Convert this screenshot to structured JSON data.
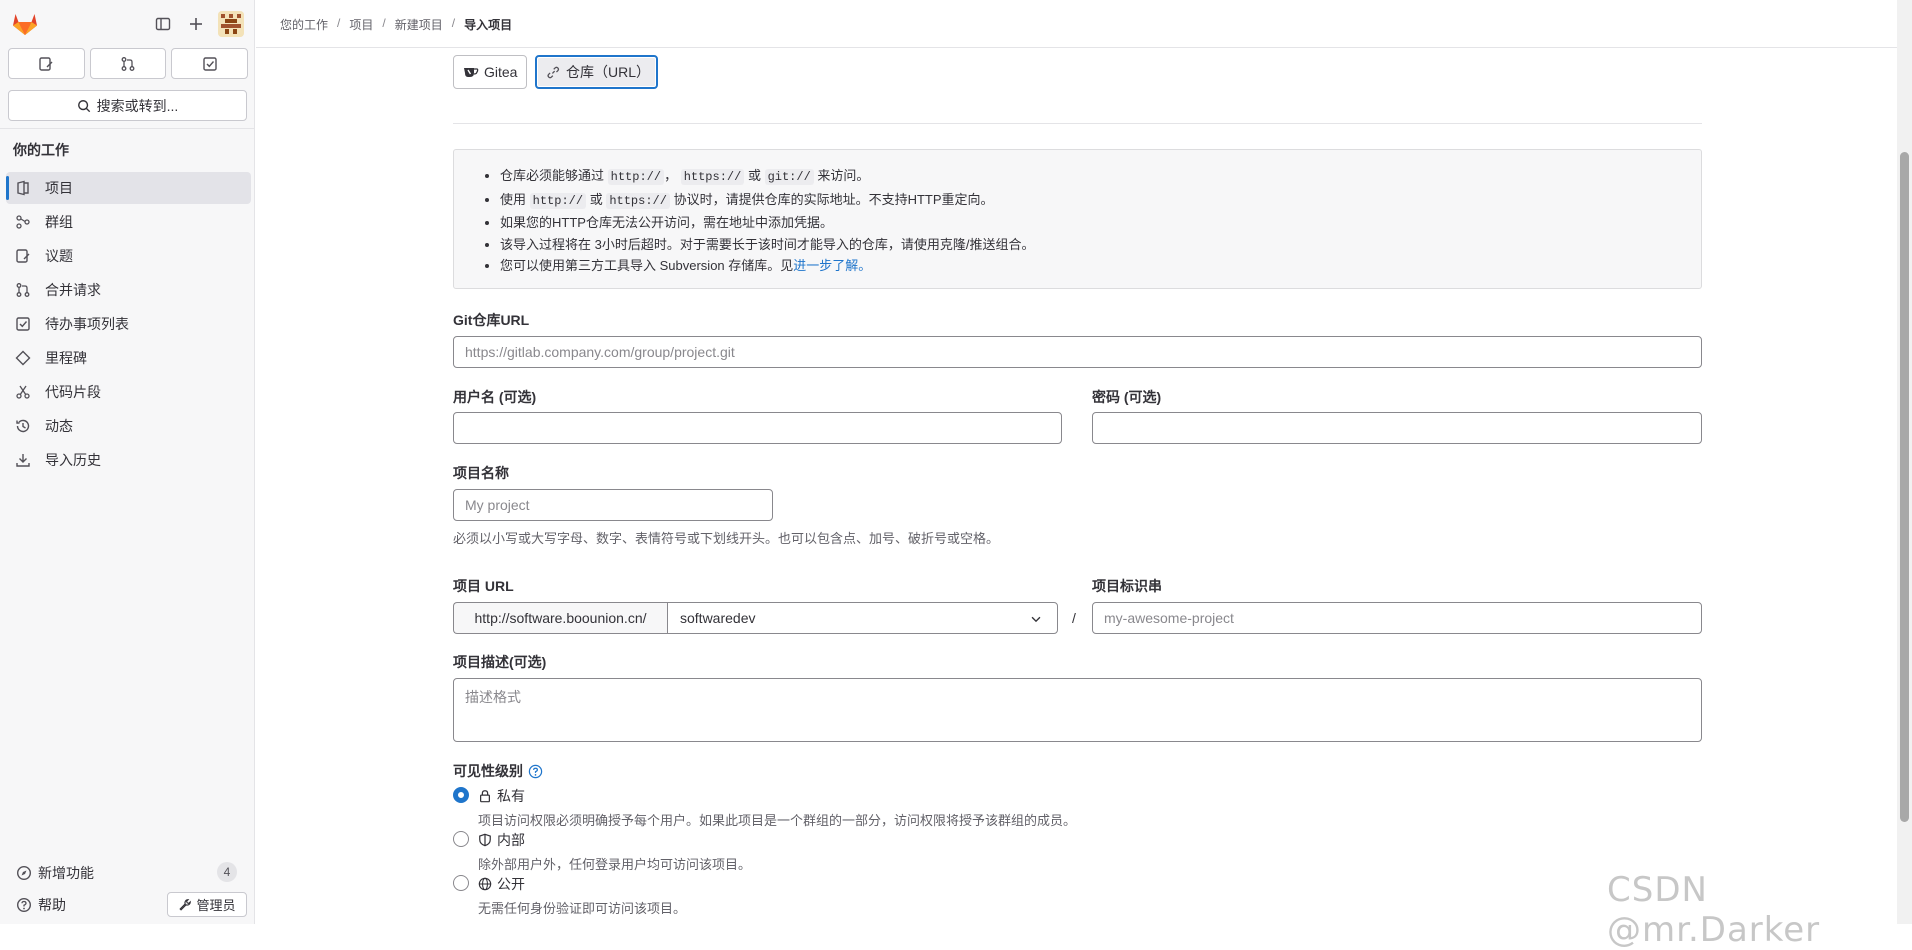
{
  "sidebar": {
    "search_label": "搜索或转到...",
    "section_title": "你的工作",
    "items": [
      {
        "label": "项目",
        "icon": "project-icon",
        "active": true
      },
      {
        "label": "群组",
        "icon": "group-icon"
      },
      {
        "label": "议题",
        "icon": "issues-icon"
      },
      {
        "label": "合并请求",
        "icon": "merge-request-icon"
      },
      {
        "label": "待办事项列表",
        "icon": "todo-icon"
      },
      {
        "label": "里程碑",
        "icon": "milestone-icon"
      },
      {
        "label": "代码片段",
        "icon": "snippet-icon"
      },
      {
        "label": "动态",
        "icon": "history-icon"
      },
      {
        "label": "导入历史",
        "icon": "import-icon"
      }
    ],
    "whats_new_label": "新增功能",
    "whats_new_count": "4",
    "help_label": "帮助",
    "admin_label": "管理员"
  },
  "breadcrumb": [
    "您的工作",
    "项目",
    "新建项目",
    "导入项目"
  ],
  "import_sources": [
    {
      "label": "Gitea",
      "icon": "gitea-icon"
    },
    {
      "label": "仓库（URL）",
      "icon": "link-icon",
      "selected": true
    }
  ],
  "info": {
    "l1_a": "仓库必须能够通过",
    "l1_code1": "http://",
    "l1_b": "，",
    "l1_code2": "https://",
    "l1_c": "或",
    "l1_code3": "git://",
    "l1_d": "来访问。",
    "l2_a": "使用",
    "l2_code1": "http://",
    "l2_b": "或",
    "l2_code2": "https://",
    "l2_c": "协议时，请提供仓库的实际地址。不支持HTTP重定向。",
    "l3": "如果您的HTTP仓库无法公开访问，需在地址中添加凭据。",
    "l4": "该导入过程将在 3小时后超时。对于需要长于该时间才能导入的仓库，请使用克隆/推送组合。",
    "l5_a": "您可以使用第三方工具导入 Subversion 存储库。见",
    "l5_link": "进一步了解。"
  },
  "form": {
    "git_url_label": "Git仓库URL",
    "git_url_placeholder": "https://gitlab.company.com/group/project.git",
    "username_label": "用户名 (可选)",
    "password_label": "密码 (可选)",
    "project_name_label": "项目名称",
    "project_name_placeholder": "My project",
    "project_name_help": "必须以小写或大写字母、数字、表情符号或下划线开头。也可以包含点、加号、破折号或空格。",
    "project_url_label": "项目 URL",
    "url_prefix": "http://software.boounion.cn/",
    "namespace_value": "softwaredev",
    "url_separator": "/",
    "slug_label": "项目标识串",
    "slug_placeholder": "my-awesome-project",
    "description_label": "项目描述(可选)",
    "description_placeholder": "描述格式",
    "visibility_label": "可见性级别",
    "visibility": [
      {
        "title": "私有",
        "desc": "项目访问权限必须明确授予每个用户。如果此项目是一个群组的一部分，访问权限将授予该群组的成员。",
        "icon": "lock-icon",
        "checked": true
      },
      {
        "title": "内部",
        "desc": "除外部用户外，任何登录用户均可访问该项目。",
        "icon": "shield-icon"
      },
      {
        "title": "公开",
        "desc": "无需任何身份验证即可访问该项目。",
        "icon": "globe-icon"
      }
    ]
  },
  "watermark": "CSDN @mr.Darker",
  "colors": {
    "accent": "#1f75cb",
    "sidebar_bg": "#f7f7f8",
    "logo": "#e24329"
  }
}
